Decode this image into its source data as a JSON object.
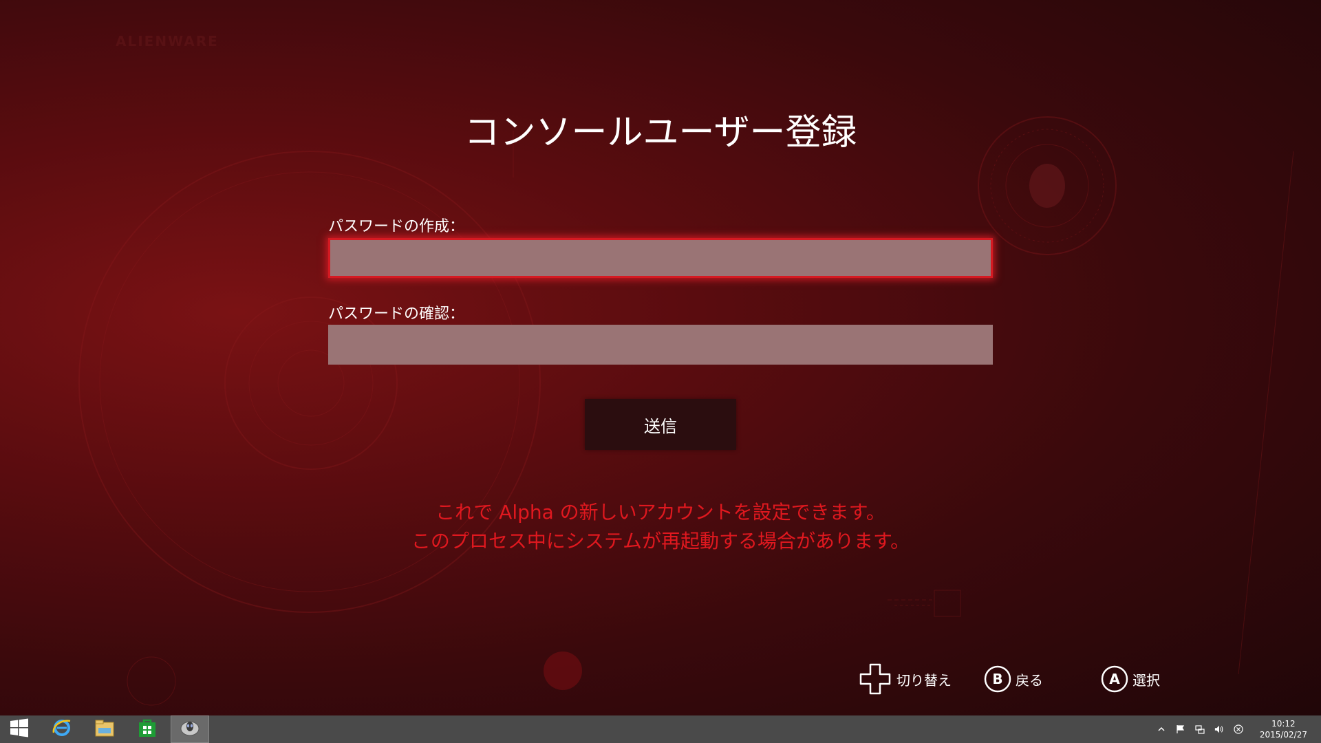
{
  "brand": {
    "name": "ALIENWARE"
  },
  "screen": {
    "title": "コンソールユーザー登録",
    "password_create_label": "パスワードの作成：",
    "password_create_value": "",
    "password_confirm_label": "パスワードの確認：",
    "password_confirm_value": "",
    "submit_label": "送信",
    "info_line1": "これで Alpha の新しいアカウントを設定できます。",
    "info_line2": "このプロセス中にシステムが再起動する場合があります。"
  },
  "hints": [
    {
      "icon": "dpad-icon",
      "label": "切り替え"
    },
    {
      "icon": "b-button-icon",
      "label": "戻る"
    },
    {
      "icon": "a-button-icon",
      "label": "選択"
    }
  ],
  "taskbar": {
    "apps": [
      "start-icon",
      "internet-explorer-icon",
      "file-explorer-icon",
      "store-icon",
      "alienware-app-icon"
    ],
    "tray_icons": [
      "show-hidden-icons-chevron",
      "action-center-flag-icon",
      "network-icon",
      "volume-icon",
      "close-circle-icon"
    ],
    "time": "10:12",
    "date": "2015/02/27"
  },
  "colors": {
    "accent_red": "#e0181f",
    "field_fill": "#9a7475",
    "button_fill": "#2b0d0f",
    "taskbar": "#4a4a4a"
  }
}
